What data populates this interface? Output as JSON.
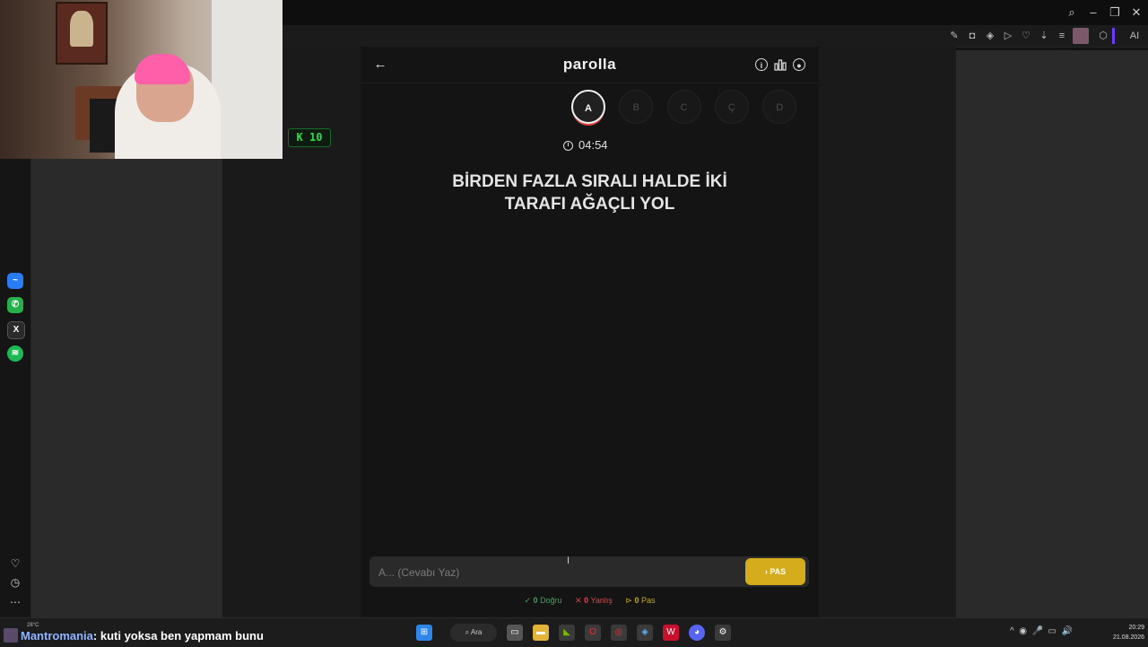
{
  "browser": {
    "window_controls": [
      "search",
      "minimize",
      "restore",
      "close"
    ],
    "toolbar_icons": [
      "edit-icon",
      "camera-icon",
      "shield-icon",
      "play-icon",
      "heart-icon",
      "download-icon",
      "menu-icon",
      "profile-icon",
      "cube-icon",
      "ai-icon"
    ],
    "ai_label": "AI"
  },
  "sidebar": {
    "apps": [
      "messenger",
      "whatsapp",
      "x",
      "spotify"
    ],
    "bottom": [
      "heart-icon",
      "history-icon",
      "more-icon"
    ]
  },
  "overlay": {
    "badge_text": "K 10"
  },
  "app": {
    "title": "parolla",
    "letters": [
      {
        "label": "A",
        "active": true
      },
      {
        "label": "B",
        "active": false
      },
      {
        "label": "C",
        "active": false
      },
      {
        "label": "Ç",
        "active": false
      },
      {
        "label": "D",
        "active": false
      }
    ],
    "timer": "04:54",
    "question_line1": "BİRDEN FAZLA SIRALI HALDE İKİ",
    "question_line2": "TARAFI AĞAÇLI YOL",
    "answer_placeholder": "A... (Cevabı Yaz)",
    "pass_label": "PAS",
    "score": {
      "correct_count": "0",
      "correct_label": "Doğru",
      "wrong_count": "0",
      "wrong_label": "Yanlış",
      "pass_count": "0",
      "pass_label": "Pas"
    }
  },
  "taskbar": {
    "weather": "28°C",
    "chat_user": "Mantromania",
    "chat_message": ": kuti yoksa ben yapmam bunu",
    "search_label": "Ara",
    "time": "20:29",
    "date": "21.08.2026"
  }
}
